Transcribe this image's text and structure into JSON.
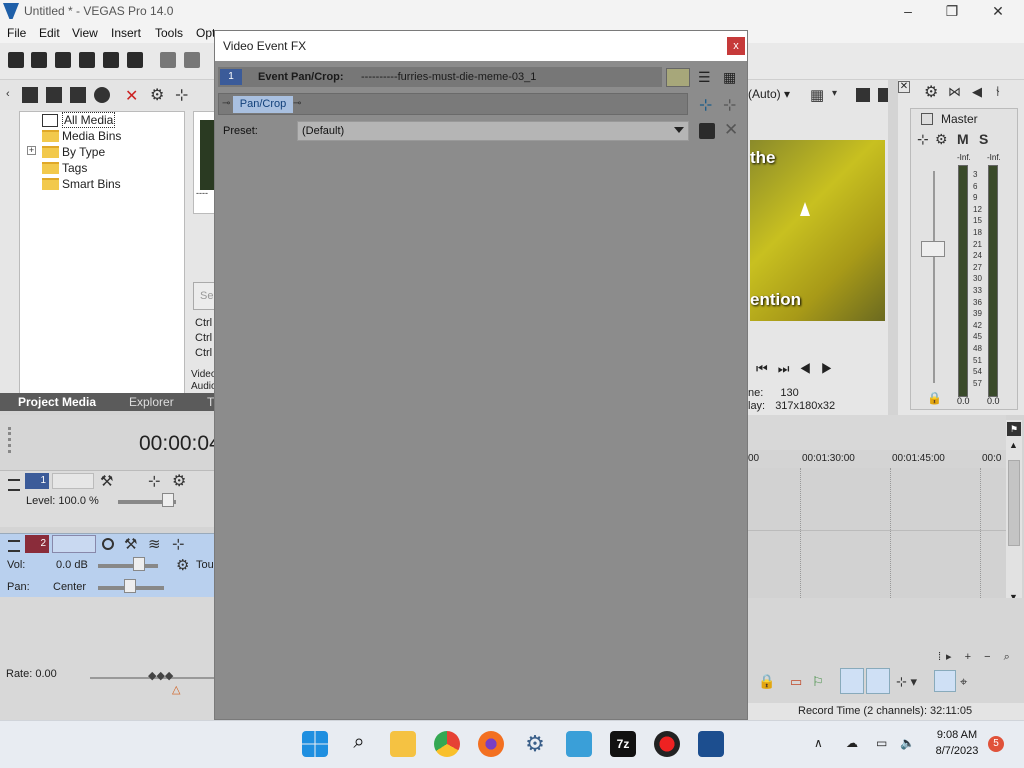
{
  "window": {
    "title": "Untitled * - VEGAS Pro 14.0"
  },
  "menubar": {
    "items": [
      "File",
      "Edit",
      "View",
      "Insert",
      "Tools",
      "Opt"
    ]
  },
  "project_media": {
    "tree": [
      "All Media",
      "Media Bins",
      "By Type",
      "Tags",
      "Smart Bins"
    ],
    "expander": "+",
    "thumb_caption": "----",
    "search_text": "Se",
    "shortcuts": [
      "Ctrl",
      "Ctrl",
      "Ctrl"
    ],
    "media_info": [
      "Video",
      "Audio"
    ],
    "tabs": [
      "Project Media",
      "Explorer",
      "T"
    ]
  },
  "timeline": {
    "time": "00:00:04",
    "track1": {
      "number": "1",
      "level_label": "Level: 100.0 %"
    },
    "track2": {
      "number": "2",
      "vol_label": "Vol:",
      "vol_value": "0.0 dB",
      "pan_label": "Pan:",
      "pan_value": "Center",
      "touch_label": "Tou"
    },
    "rate_label": "Rate: 0.00",
    "ruler_ticks": [
      "00",
      "00:01:30:00",
      "00:01:45:00",
      "00:0"
    ]
  },
  "preview": {
    "quality": "(Auto)",
    "overlay_top": "the",
    "overlay_bottom": "ention",
    "frame_label": "ne:",
    "frame_value": "130",
    "display_label": "lay:",
    "display_value": "317x180x32"
  },
  "master": {
    "title": "Master",
    "m_label": "M",
    "s_label": "S",
    "peak_left": "-Inf.",
    "peak_right": "-Inf.",
    "scale": [
      "3",
      "6",
      "9",
      "12",
      "15",
      "18",
      "21",
      "24",
      "27",
      "30",
      "33",
      "36",
      "39",
      "42",
      "45",
      "48",
      "51",
      "54",
      "57"
    ],
    "level_left": "0.0",
    "level_right": "0.0"
  },
  "status": {
    "record_time": "Record Time (2 channels): 32:11:05"
  },
  "dialog": {
    "title": "Video Event FX",
    "close": "x",
    "chain_number": "1",
    "chain_title": "Event Pan/Crop:",
    "chain_name": "----------furries-must-die-meme-03_1",
    "plugin": "Pan/Crop",
    "preset_label": "Preset:",
    "preset_value": "(Default)"
  },
  "taskbar": {
    "time": "9:08 AM",
    "date": "8/7/2023",
    "notifications": "5",
    "apps": [
      "start",
      "search",
      "file-explorer",
      "chrome",
      "firefox",
      "settings",
      "notepad",
      "7zip",
      "obs",
      "vegas"
    ]
  },
  "colors": {
    "dialog_bg": "#8c8c8c",
    "accent": "#3b5b99",
    "track_audio": "#b9d0ee"
  }
}
